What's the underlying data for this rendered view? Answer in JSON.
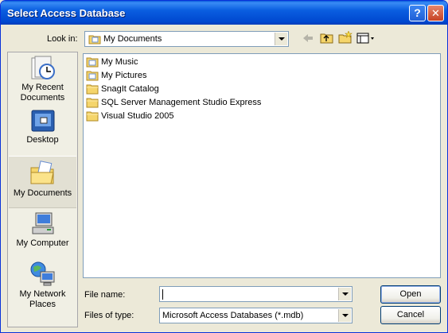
{
  "window": {
    "title": "Select Access Database",
    "help_button": "?",
    "close_button": "✕"
  },
  "lookin": {
    "label": "Look in:",
    "value": "My Documents"
  },
  "places": [
    {
      "label": "My Recent Documents",
      "icon": "recent-documents-icon"
    },
    {
      "label": "Desktop",
      "icon": "desktop-icon"
    },
    {
      "label": "My Documents",
      "icon": "my-documents-icon",
      "selected": true
    },
    {
      "label": "My Computer",
      "icon": "my-computer-icon"
    },
    {
      "label": "My Network Places",
      "icon": "network-places-icon"
    }
  ],
  "files": [
    {
      "name": "My Music",
      "icon": "special-folder-icon"
    },
    {
      "name": "My Pictures",
      "icon": "special-folder-icon"
    },
    {
      "name": "SnagIt Catalog",
      "icon": "folder-icon"
    },
    {
      "name": "SQL Server Management Studio Express",
      "icon": "folder-icon"
    },
    {
      "name": "Visual Studio 2005",
      "icon": "folder-icon"
    }
  ],
  "filename": {
    "label": "File name:",
    "value": ""
  },
  "filetype": {
    "label": "Files of type:",
    "value": "Microsoft Access Databases (*.mdb)"
  },
  "buttons": {
    "open": "Open",
    "cancel": "Cancel"
  }
}
